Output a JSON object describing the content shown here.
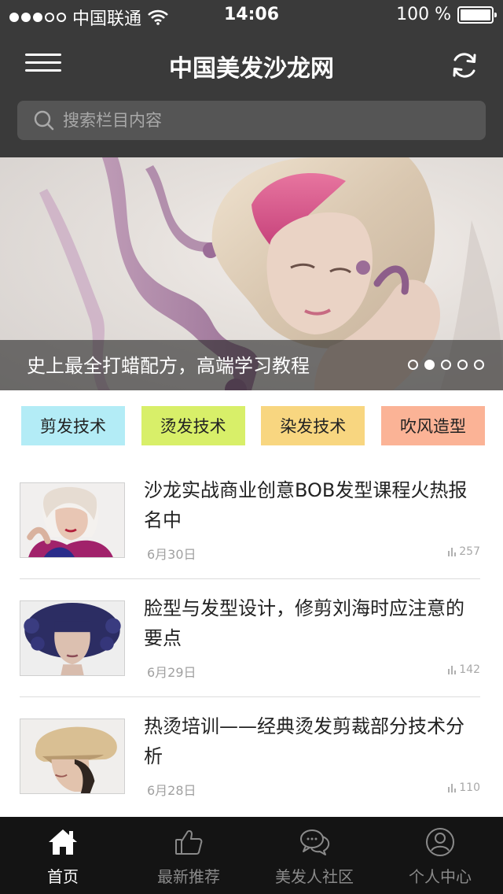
{
  "status_bar": {
    "carrier": "中国联通",
    "time": "14:06",
    "battery": "100 %"
  },
  "header": {
    "title": "中国美发沙龙网",
    "menu_icon": "menu-icon",
    "refresh_icon": "refresh-icon"
  },
  "search": {
    "placeholder": "搜索栏目内容",
    "icon": "search-icon"
  },
  "banner": {
    "caption": "史上最全打蜡配方，高端学习教程",
    "page_count": 5,
    "active_index": 1
  },
  "categories": [
    {
      "label": "剪发技术",
      "color": "#b3ecf6"
    },
    {
      "label": "烫发技术",
      "color": "#d8ef69"
    },
    {
      "label": "染发技术",
      "color": "#f8d680"
    },
    {
      "label": "吹风造型",
      "color": "#fbb396"
    }
  ],
  "articles": [
    {
      "title": "沙龙实战商业创意BOB发型课程火热报名中",
      "date": "6月30日",
      "views": "257"
    },
    {
      "title": "脸型与发型设计，修剪刘海时应注意的要点",
      "date": "6月29日",
      "views": "142"
    },
    {
      "title": "热烫培训——经典烫发剪裁部分技术分析",
      "date": "6月28日",
      "views": "110"
    }
  ],
  "tabbar": {
    "items": [
      {
        "label": "首页",
        "icon": "home-icon",
        "active": true
      },
      {
        "label": "最新推荐",
        "icon": "thumbs-up-icon",
        "active": false
      },
      {
        "label": "美发人社区",
        "icon": "chat-bubbles-icon",
        "active": false
      },
      {
        "label": "个人中心",
        "icon": "user-icon",
        "active": false
      }
    ]
  },
  "colors": {
    "header_bg": "#3a3a3a",
    "search_bg": "#555555",
    "tabbar_bg": "#141414"
  }
}
